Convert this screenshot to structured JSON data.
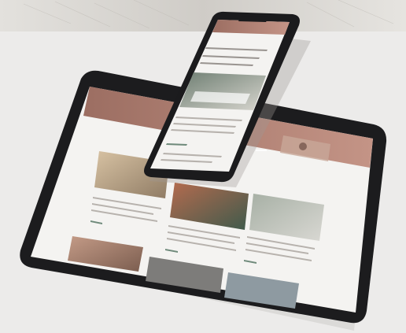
{
  "scene": {
    "subject": "tablet-and-smartphone-mockup",
    "background_color": "#ecebea",
    "fabric_color": "#d9d7d3",
    "device_frame_color": "#1c1c1e",
    "screen_header_color": "#a5776a",
    "card_text_color": "#b7b2ad",
    "link_accent_color": "#6f8a7b"
  },
  "tablet": {
    "cards": [
      {
        "name": "interior-photo-card-1"
      },
      {
        "name": "interior-photo-card-2"
      },
      {
        "name": "interior-photo-card-3"
      },
      {
        "name": "interior-photo-card-4"
      },
      {
        "name": "interior-photo-card-5"
      },
      {
        "name": "interior-photo-card-6"
      }
    ]
  },
  "phone": {
    "sections": [
      "hero-photo",
      "article-text",
      "article-text"
    ]
  }
}
